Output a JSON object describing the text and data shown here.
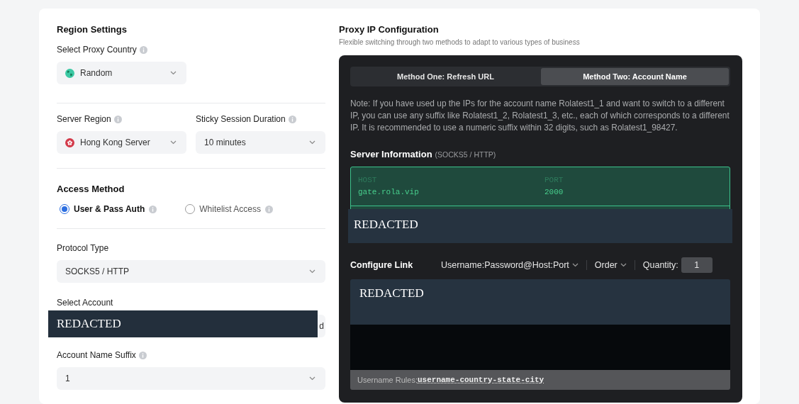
{
  "region_settings": {
    "title": "Region Settings",
    "country": {
      "label": "Select Proxy Country",
      "info": true,
      "value": "Random",
      "kind": "globe"
    },
    "server_region": {
      "label": "Server Region",
      "info": true,
      "value": "Hong Kong Server",
      "kind": "flag"
    },
    "sticky_session": {
      "label": "Sticky Session Duration",
      "info": true,
      "value": "10 minutes"
    }
  },
  "access_method": {
    "title": "Access Method",
    "options": [
      {
        "label": "User & Pass Auth",
        "info": true,
        "selected": true
      },
      {
        "label": "Whitelist Access",
        "info": true,
        "selected": false
      }
    ]
  },
  "protocol": {
    "label": "Protocol Type",
    "info": false,
    "value": "SOCKS5 / HTTP"
  },
  "account": {
    "label": "Select Account",
    "redaction": "REDACTED",
    "visible_fragment": "d"
  },
  "suffix": {
    "label": "Account Name Suffix",
    "info": true,
    "value": "1"
  },
  "proxy_config": {
    "title": "Proxy IP Configuration",
    "subtitle": "Flexible switching through two methods to adapt to various types of business",
    "tabs": [
      {
        "label": "Method One: Refresh URL",
        "selected": false
      },
      {
        "label": "Method Two: Account Name",
        "selected": true
      }
    ],
    "note": "Note: If you have used up the IPs for the account name Rolatest1_1 and want to switch to a different IP, you can use any suffix like Rolatest1_2, Rolatest1_3, etc., each of which corresponds to a different IP. It is recommended to use a numeric suffix within 32 digits, such as Rolatest1_98427.",
    "server_info": {
      "title": "Server Information",
      "subtitle": "(SOCKS5 / HTTP)",
      "columns": [
        {
          "header": "HOST",
          "value": "gate.rola.vip"
        },
        {
          "header": "PORT",
          "value": "2000"
        }
      ],
      "redaction": "REDACTED"
    },
    "configure_link": {
      "title": "Configure Link",
      "format": "Username:Password@Host:Port",
      "order": "Order",
      "quantity_label": "Quantity:",
      "quantity": "1",
      "redaction": "REDACTED",
      "rules_label": "Username Rules:",
      "rules": "username-country-state-city"
    }
  }
}
